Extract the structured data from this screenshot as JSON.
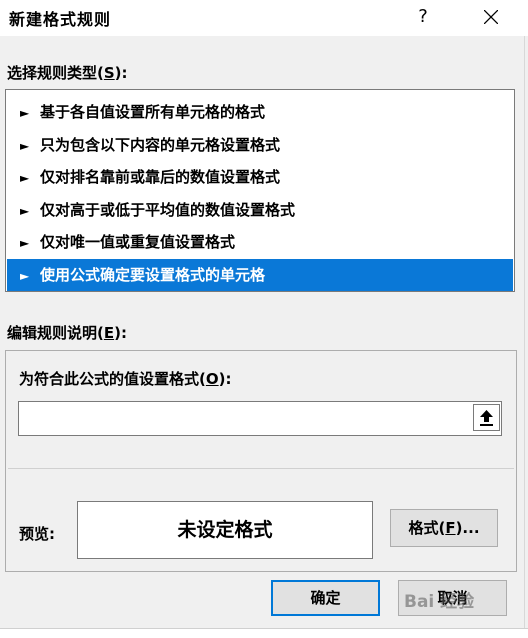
{
  "window": {
    "title": "新建格式规则",
    "help_glyph": "?"
  },
  "rule_type": {
    "label_text": "选择规则类型(",
    "label_key": "S",
    "label_tail": "):",
    "items": [
      {
        "label": "基于各自值设置所有单元格的格式",
        "selected": false
      },
      {
        "label": "只为包含以下内容的单元格设置格式",
        "selected": false
      },
      {
        "label": "仅对排名靠前或靠后的数值设置格式",
        "selected": false
      },
      {
        "label": "仅对高于或低于平均值的数值设置格式",
        "selected": false
      },
      {
        "label": "仅对唯一值或重复值设置格式",
        "selected": false
      },
      {
        "label": "使用公式确定要设置格式的单元格",
        "selected": true
      }
    ],
    "arrow_glyph": "►"
  },
  "edit_desc": {
    "label_text": "编辑规则说明(",
    "label_key": "E",
    "label_tail": "):",
    "formula_label_text": "为符合此公式的值设置格式(",
    "formula_label_key": "O",
    "formula_label_tail": "):",
    "formula_value": "",
    "preview_label": "预览:",
    "preview_text": "未设定格式",
    "format_button_text": "格式(",
    "format_button_key": "F",
    "format_button_tail": ")..."
  },
  "buttons": {
    "ok": "确定",
    "cancel": "取消"
  },
  "watermark": "Bai 经验",
  "colors": {
    "selection": "#0a78d7",
    "default_button_border": "#0078d7"
  }
}
